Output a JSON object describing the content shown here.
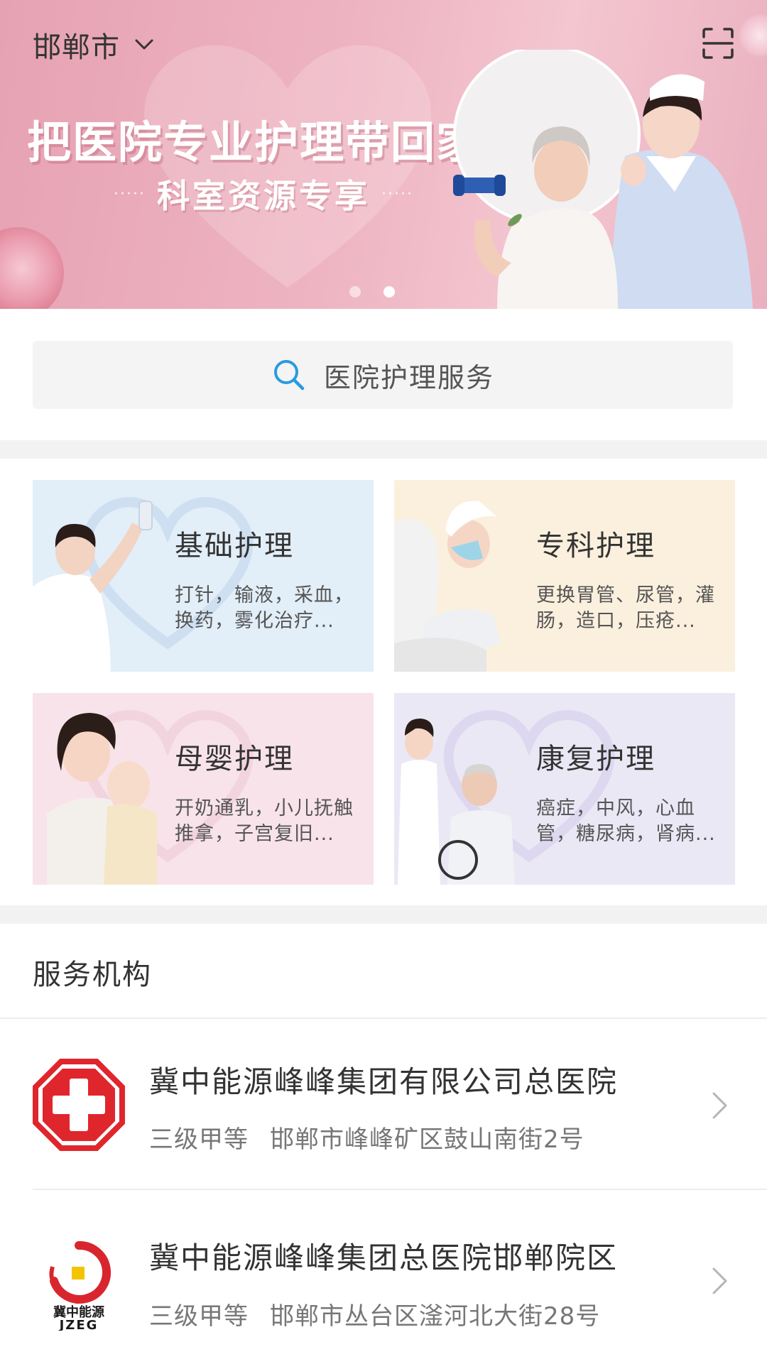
{
  "header": {
    "city": "邯郸市",
    "city_dropdown_icon": "chevron-down-icon",
    "scan_icon": "scan-icon"
  },
  "banner": {
    "slogan": "把医院专业护理带回家",
    "subslogan": "科室资源专享",
    "slide_count": 2,
    "active_slide": 2
  },
  "search": {
    "placeholder": "医院护理服务",
    "icon": "search-icon"
  },
  "services": [
    {
      "title": "基础护理",
      "desc": "打针，输液，采血，换药，雾化治疗..."
    },
    {
      "title": "专科护理",
      "desc": "更换胃管、尿管，灌肠，造口，压疮..."
    },
    {
      "title": "母婴护理",
      "desc": "开奶通乳，小儿抚触推拿，子宫复旧..."
    },
    {
      "title": "康复护理",
      "desc": "癌症，中风，心血管，糖尿病，肾病..."
    }
  ],
  "institutions_section": {
    "title": "服务机构",
    "items": [
      {
        "name": "冀中能源峰峰集团有限公司总医院",
        "level": "三级甲等",
        "address": "邯郸市峰峰矿区鼓山南街2号"
      },
      {
        "name": "冀中能源峰峰集团总医院邯郸院区",
        "level": "三级甲等",
        "address": "邯郸市丛台区滏河北大街28号",
        "logo_text": "冀中能源",
        "logo_abbr": "JZEG"
      }
    ]
  },
  "colors": {
    "banner_pink": "#eeb4c2",
    "search_icon_blue": "#2a9be0",
    "hospital_red": "#e0262d",
    "card_blue": "#e2eef8",
    "card_cream": "#fbf0de",
    "card_pink": "#f8e3ea",
    "card_lavender": "#ebe8f6"
  }
}
